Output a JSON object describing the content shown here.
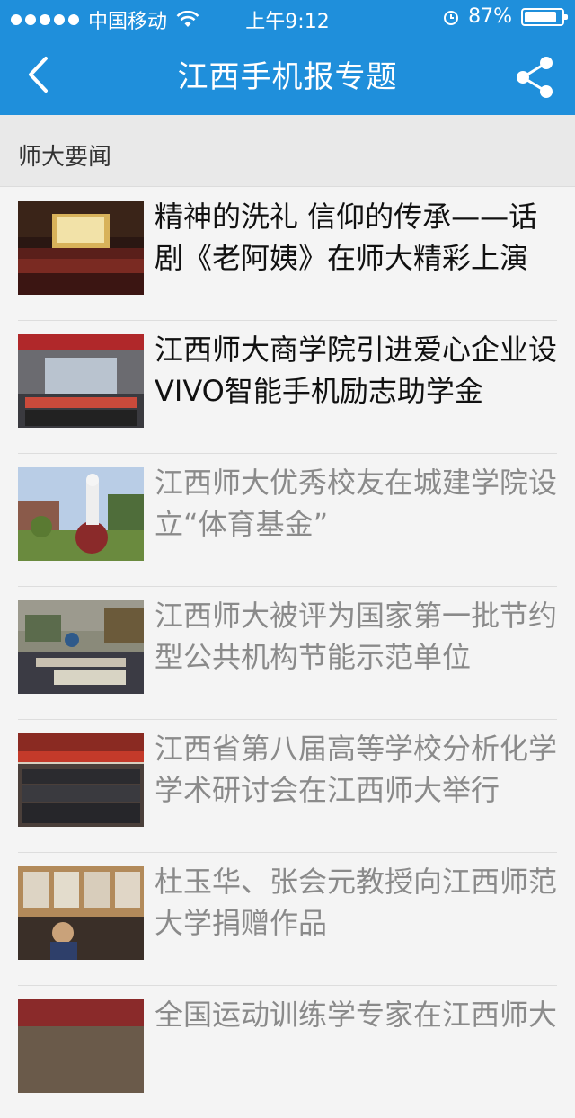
{
  "status": {
    "carrier": "中国移动",
    "time": "上午9:12",
    "battery": "87%",
    "battery_level": 0.87
  },
  "nav": {
    "title": "江西手机报专题",
    "back_icon": "chevron-left-icon",
    "share_icon": "share-icon"
  },
  "section": {
    "title": "师大要闻"
  },
  "articles": [
    {
      "title": "精神的洗礼  信仰的传承——话剧《老阿姨》在师大精彩上演",
      "read": false,
      "image": "theater-stage"
    },
    {
      "title": "江西师大商学院引进爱心企业设VIVO智能手机励志助学金",
      "read": false,
      "image": "group-ceremony"
    },
    {
      "title": "江西师大优秀校友在城建学院设立“体育基金”",
      "read": true,
      "image": "campus-statue"
    },
    {
      "title": "江西师大被评为国家第一批节约型公共机构节能示范单位",
      "read": true,
      "image": "outdoor-market"
    },
    {
      "title": "江西省第八届高等学校分析化学学术研讨会在江西师大举行",
      "read": true,
      "image": "group-photo"
    },
    {
      "title": "杜玉华、张会元教授向江西师范大学捐赠作品",
      "read": true,
      "image": "art-exhibition"
    },
    {
      "title": "全国运动训练学专家在江西师大",
      "read": true,
      "image": "event"
    }
  ]
}
